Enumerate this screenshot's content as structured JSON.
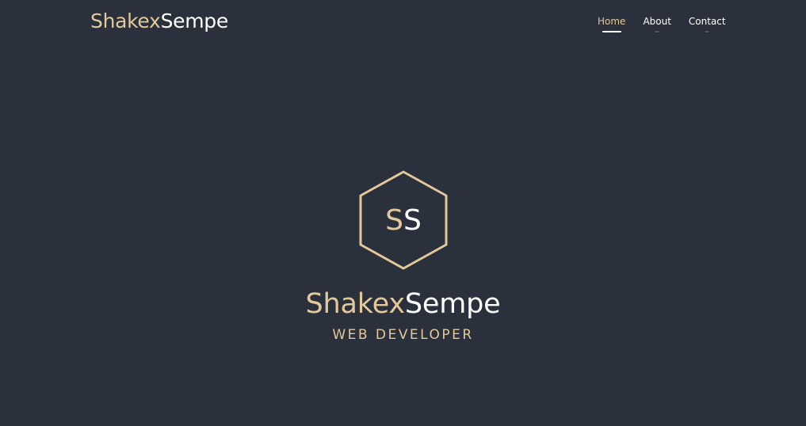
{
  "brand": {
    "part1": "Shakex",
    "part2": "Sempe"
  },
  "nav": {
    "items": [
      {
        "label": "Home",
        "active": true
      },
      {
        "label": "About",
        "active": false
      },
      {
        "label": "Contact",
        "active": false
      }
    ]
  },
  "hero": {
    "monogram_letter1": "S",
    "monogram_letter2": "S",
    "title_part1": "Shakex",
    "title_part2": "Sempe",
    "subtitle": "WEB DEVELOPER"
  },
  "colors": {
    "background": "#2a313c",
    "accent_gold": "#e3c99a",
    "text_white": "#ffffff"
  }
}
